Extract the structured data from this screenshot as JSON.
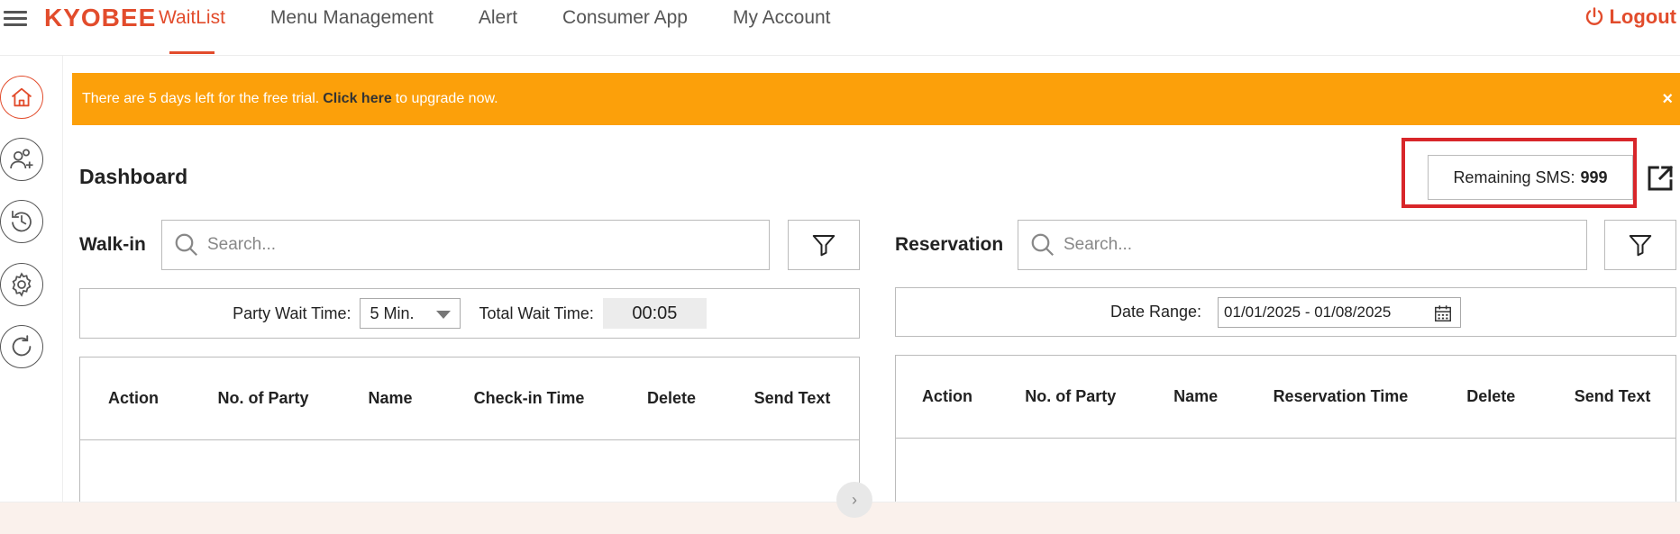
{
  "header": {
    "brand": "KYOBEE",
    "nav": [
      "WaitList",
      "Menu Management",
      "Alert",
      "Consumer App",
      "My Account"
    ],
    "logout_label": "Logout"
  },
  "sidebar": {
    "items": [
      "home-icon",
      "add-user-icon",
      "history-icon",
      "settings-icon",
      "refresh-icon"
    ]
  },
  "banner": {
    "text_before": "There are 5 days left for the free trial.",
    "link": "Click here",
    "text_after": "to upgrade now.",
    "close": "×"
  },
  "dashboard": {
    "title": "Dashboard",
    "sms_label": "Remaining SMS:",
    "sms_value": "999"
  },
  "walkin": {
    "label": "Walk-in",
    "search_placeholder": "Search...",
    "party_wait_label": "Party Wait Time:",
    "party_wait_value": "5 Min.",
    "total_wait_label": "Total Wait Time:",
    "total_wait_value": "00:05",
    "columns": [
      "Action",
      "No. of Party",
      "Name",
      "Check-in Time",
      "Delete",
      "Send Text"
    ]
  },
  "reservation": {
    "label": "Reservation",
    "search_placeholder": "Search...",
    "date_range_label": "Date Range:",
    "date_range_value": "01/01/2025 - 01/08/2025",
    "columns": [
      "Action",
      "No. of Party",
      "Name",
      "Reservation Time",
      "Delete",
      "Send Text"
    ]
  },
  "colors": {
    "brand": "#e24c2c",
    "banner": "#fca00a",
    "highlight": "#d8262a"
  }
}
